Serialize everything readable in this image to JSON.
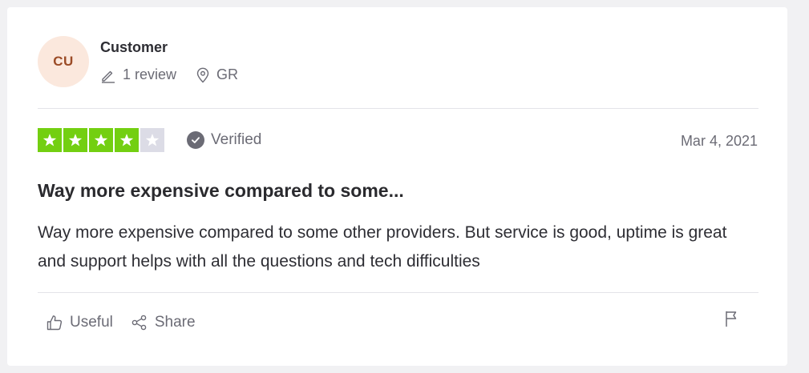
{
  "reviewer": {
    "initials": "CU",
    "name": "Customer",
    "review_count": "1 review",
    "country": "GR"
  },
  "review": {
    "rating": 4,
    "rating_max": 5,
    "verified_label": "Verified",
    "date": "Mar 4, 2021",
    "title": "Way more expensive compared to some...",
    "text": "Way more expensive compared to some other providers. But service is good, uptime is great and support helps with all the questions and tech difficulties"
  },
  "actions": {
    "useful_label": "Useful",
    "share_label": "Share"
  },
  "colors": {
    "star_active": "#73cf11",
    "star_inactive": "#dcdce6",
    "avatar_bg": "#fbe8dd",
    "avatar_text": "#9b4b26"
  },
  "icons": {
    "review_count": "pencil-icon",
    "country": "location-pin-icon",
    "verified": "check-circle-icon",
    "useful": "thumbs-up-icon",
    "share": "share-icon",
    "report": "flag-icon"
  }
}
